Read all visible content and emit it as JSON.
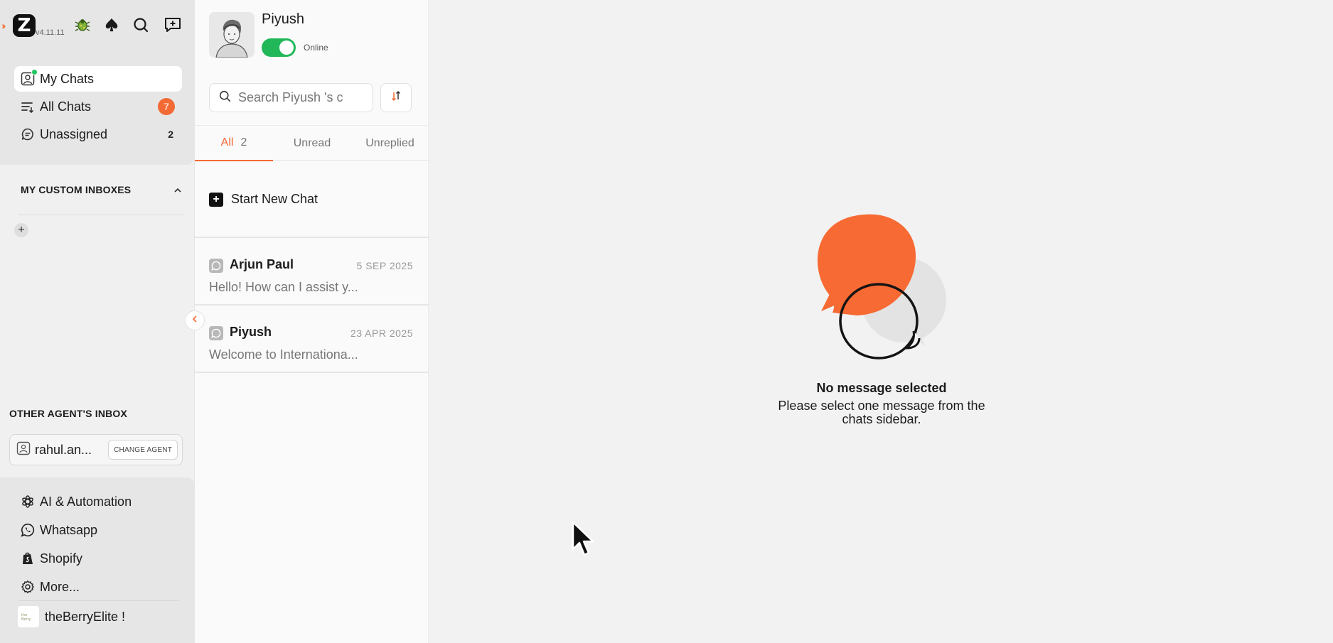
{
  "app": {
    "version": "v4.11.11"
  },
  "sidebar": {
    "nav": [
      {
        "label": "My Chats"
      },
      {
        "label": "All Chats",
        "badge": "7"
      },
      {
        "label": "Unassigned",
        "count": "2"
      }
    ],
    "custom_inboxes_title": "MY CUSTOM INBOXES",
    "other_inbox_title": "OTHER AGENT'S INBOX",
    "agent": {
      "name": "rahul.an...",
      "change_label": "CHANGE AGENT"
    },
    "bottom": [
      {
        "label": "AI & Automation"
      },
      {
        "label": "Whatsapp"
      },
      {
        "label": "Shopify"
      },
      {
        "label": "More..."
      }
    ],
    "store_name": "theBerryElite !"
  },
  "panel": {
    "user_name": "Piyush",
    "status": "Online",
    "search_placeholder": "Search Piyush 's c",
    "tabs": [
      {
        "label": "All",
        "count": "2"
      },
      {
        "label": "Unread"
      },
      {
        "label": "Unreplied"
      }
    ],
    "new_chat_label": "Start New Chat",
    "chats": [
      {
        "name": "Arjun Paul",
        "date": "5 SEP 2025",
        "preview": "Hello! How can I assist y..."
      },
      {
        "name": "Piyush",
        "date": "23 APR 2025",
        "preview": "Welcome to Internationa..."
      }
    ]
  },
  "main": {
    "empty_title": "No message selected",
    "empty_subtitle_1": "Please select one message from the",
    "empty_subtitle_2": "chats sidebar."
  },
  "colors": {
    "accent": "#f36a34",
    "online": "#22b85a"
  }
}
